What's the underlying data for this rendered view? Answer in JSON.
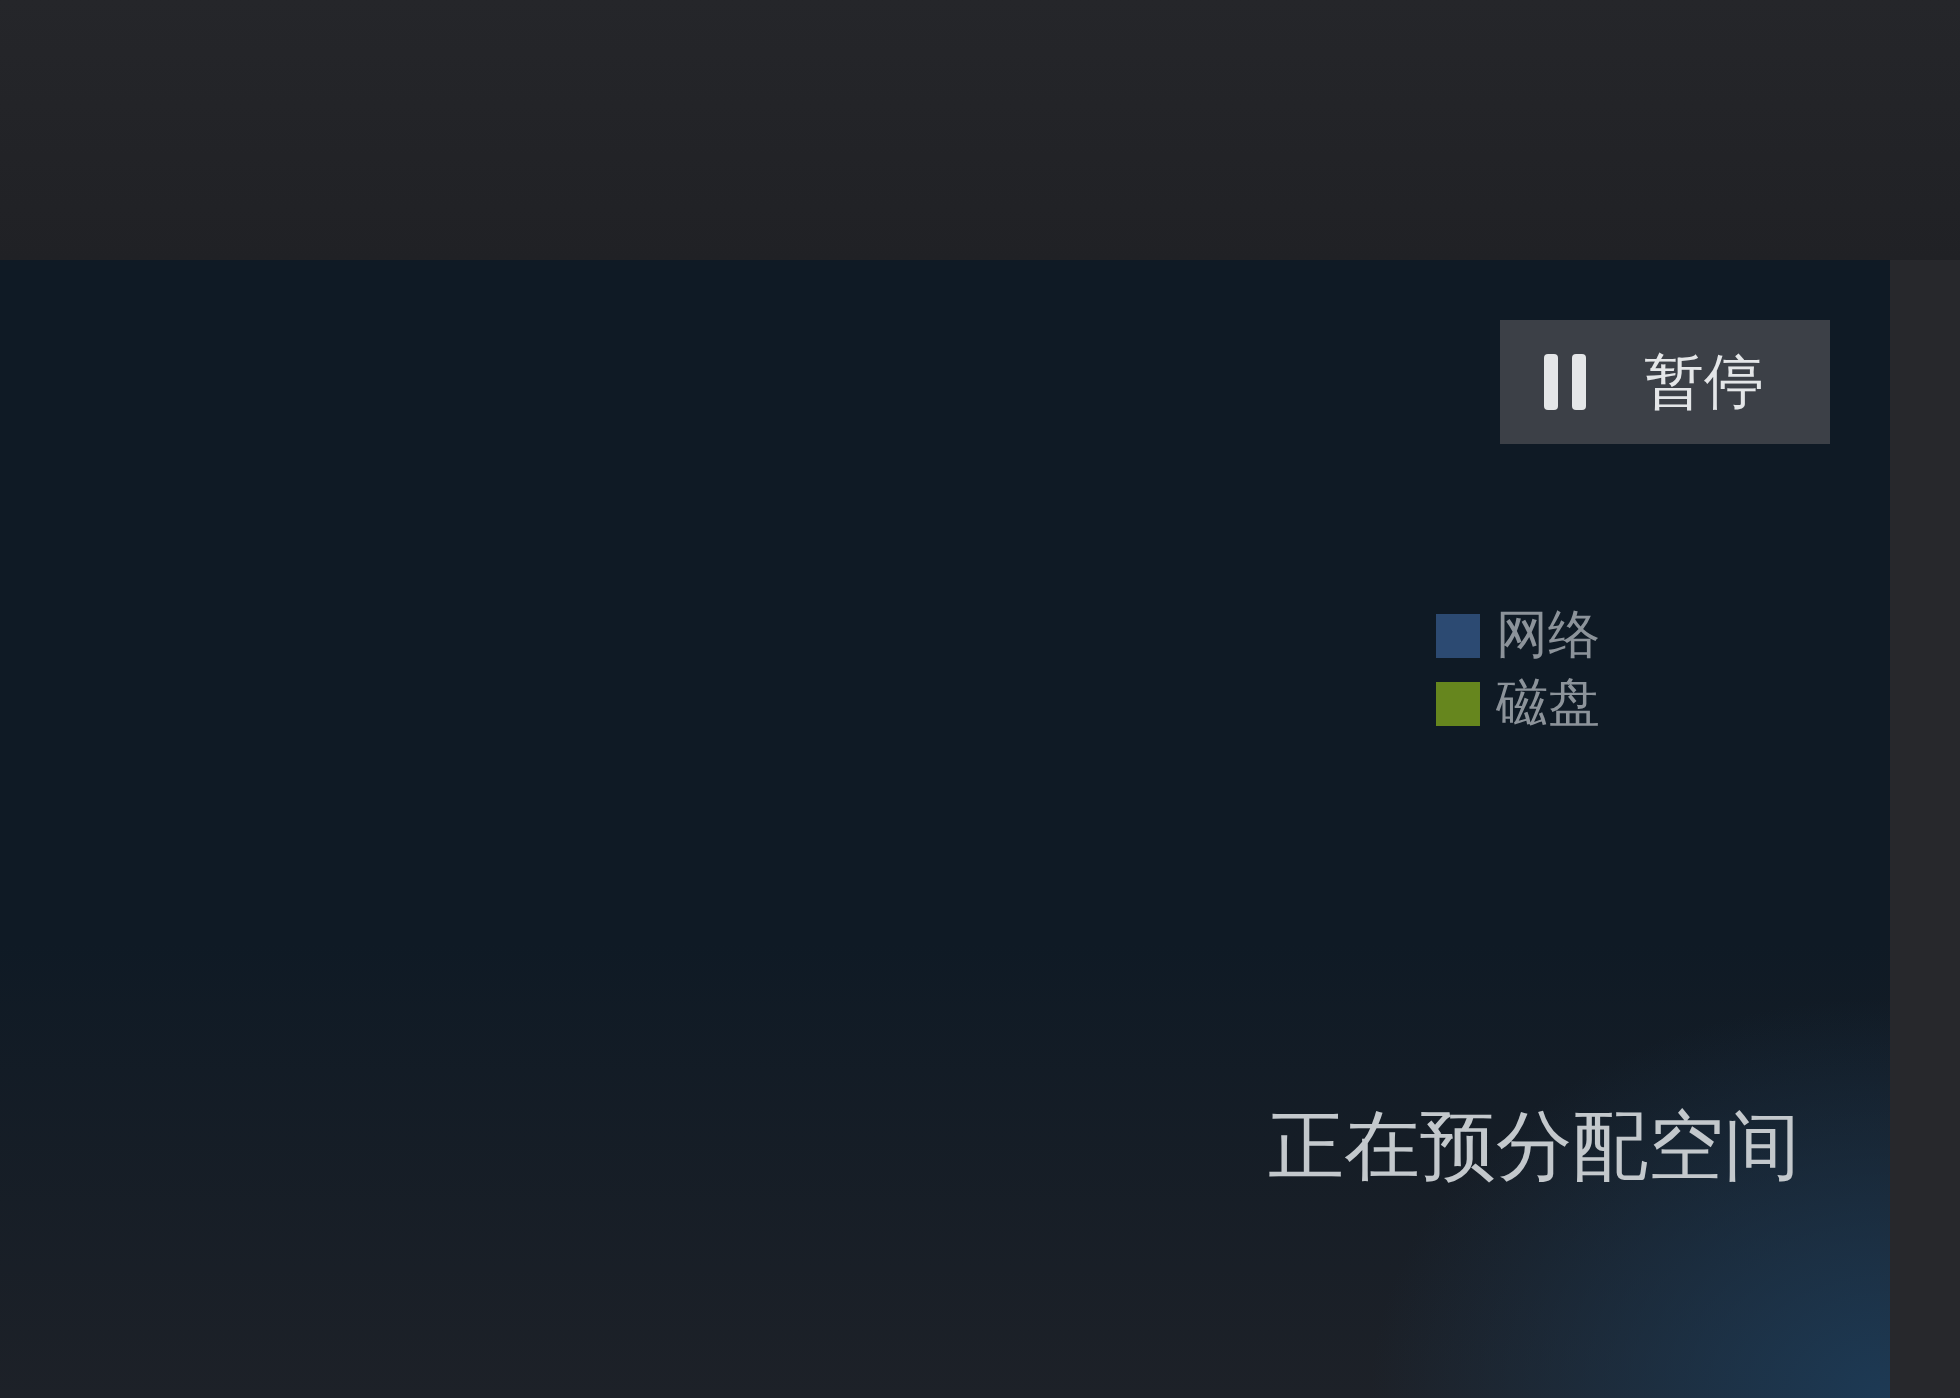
{
  "pause_button": {
    "label": "暂停"
  },
  "legend": [
    {
      "label": "网络",
      "color": "#2c4a72"
    },
    {
      "label": "磁盘",
      "color": "#66861e"
    }
  ],
  "status": "正在预分配空间"
}
